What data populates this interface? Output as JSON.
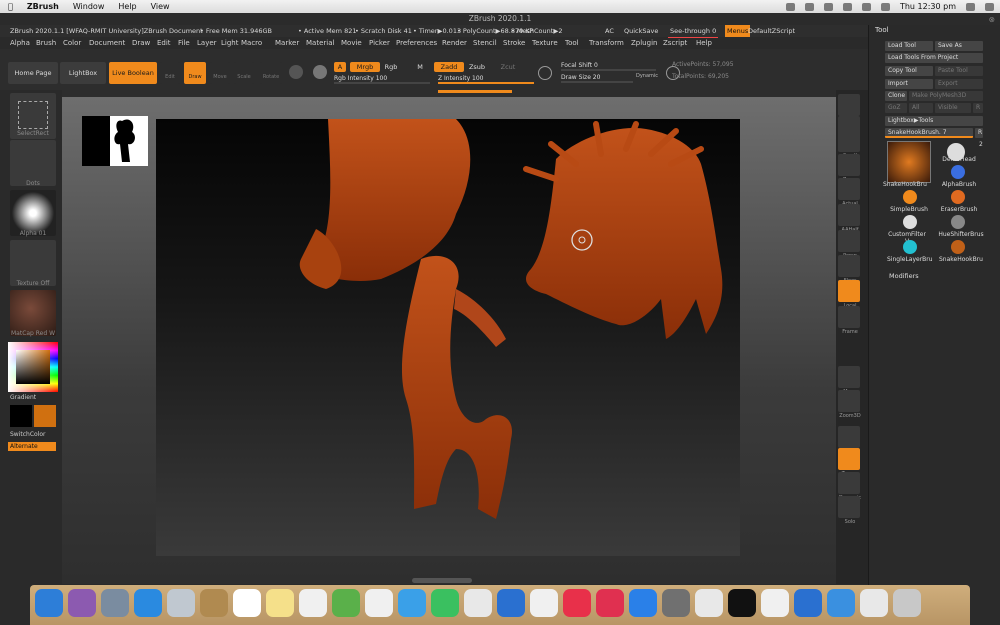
{
  "macmenu": {
    "app": "ZBrush",
    "items": [
      "Window",
      "Help",
      "View"
    ],
    "clock": "Thu 12:30 pm"
  },
  "window_title": "ZBrush 2020.1.1",
  "infobar": {
    "doc": "ZBrush 2020.1.1 [WFAQ-RMIT University]ZBrush Document",
    "freemem": "• Free Mem 31.946GB",
    "activemem": "• Active Mem 821",
    "scratch": "• Scratch Disk 41",
    "timer": "• Timer▶0.013",
    "poly": "• PolyCount▶68.879 KP",
    "mesh": "• MeshCount▶2",
    "ac": "AC",
    "quicksave": "QuickSave",
    "seethrough": "See-through  0",
    "menus": "Menus",
    "zscript": "DefaultZScript"
  },
  "menu": [
    "Alpha",
    "Brush",
    "Color",
    "Document",
    "Draw",
    "Edit",
    "File",
    "Layer",
    "Light",
    "Macro",
    "Marker",
    "Material",
    "Movie",
    "Picker",
    "Preferences",
    "Render",
    "Stencil",
    "Stroke",
    "Texture",
    "Tool",
    "Transform",
    "Zplugin",
    "Zscript",
    "Help"
  ],
  "toolbar": {
    "home": "Home Page",
    "lightbox": "LightBox",
    "liveboolean": "Live Boolean",
    "edit": "Edit",
    "draw": "Draw",
    "move": "Move",
    "scale": "Scale",
    "rotate": "Rotate",
    "a": "A",
    "mrgb": "Mrgb",
    "rgb": "Rgb",
    "m": "M",
    "zadd": "Zadd",
    "zsub": "Zsub",
    "zcut": "Zcut",
    "rgb_int": "Rgb Intensity 100",
    "z_int": "Z Intensity 100",
    "focal": "Focal Shift 0",
    "drawsize": "Draw Size 20",
    "dynamic": "Dynamic",
    "activepoints": "ActivePoints: 57,095",
    "totalpoints": "TotalPoints: 69,205"
  },
  "left": {
    "selectrect": "SelectRect",
    "dots": "Dots",
    "alpha": "Alpha 01",
    "texture": "Texture Off",
    "matcap": "MatCap Red W",
    "gradient": "Gradient",
    "switch": "SwitchColor",
    "alternate": "Alternate"
  },
  "right": [
    "BPR",
    "SPix",
    "Scroll",
    "Zoom",
    "Actual",
    "AAHalf",
    "Persp",
    "Floor",
    "Local",
    "Frame",
    "Move",
    "Zoom3D",
    "Rotate",
    "Transp",
    "Dynamic",
    "Solo"
  ],
  "tool": {
    "title": "Tool",
    "load": "Load Tool",
    "saveas": "Save As",
    "loadproj": "Load Tools From Project",
    "copy": "Copy Tool",
    "paste": "Paste Tool",
    "import": "Import",
    "export": "Export",
    "clone": "Clone",
    "makepoly": "Make PolyMesh3D",
    "goz": "GoZ",
    "all": "All",
    "visible": "Visible",
    "r": "R",
    "lbtools": "Lightbox▶Tools",
    "current": "SnakeHookBrush. 7",
    "rbtn": "R",
    "count": "2",
    "brushes": [
      "SnakeHookBru",
      "DemoHead",
      "AlphaBrush",
      "SimpleBrush",
      "EraserBrush",
      "CustomFilter V",
      "HueShifterBrus",
      "SingleLayerBru",
      "SnakeHookBru"
    ],
    "modifiers": "Modifiers"
  },
  "colors": {
    "accent": "#f08a1c",
    "model": "#b84a10",
    "canvas": "#0a0a0a"
  }
}
